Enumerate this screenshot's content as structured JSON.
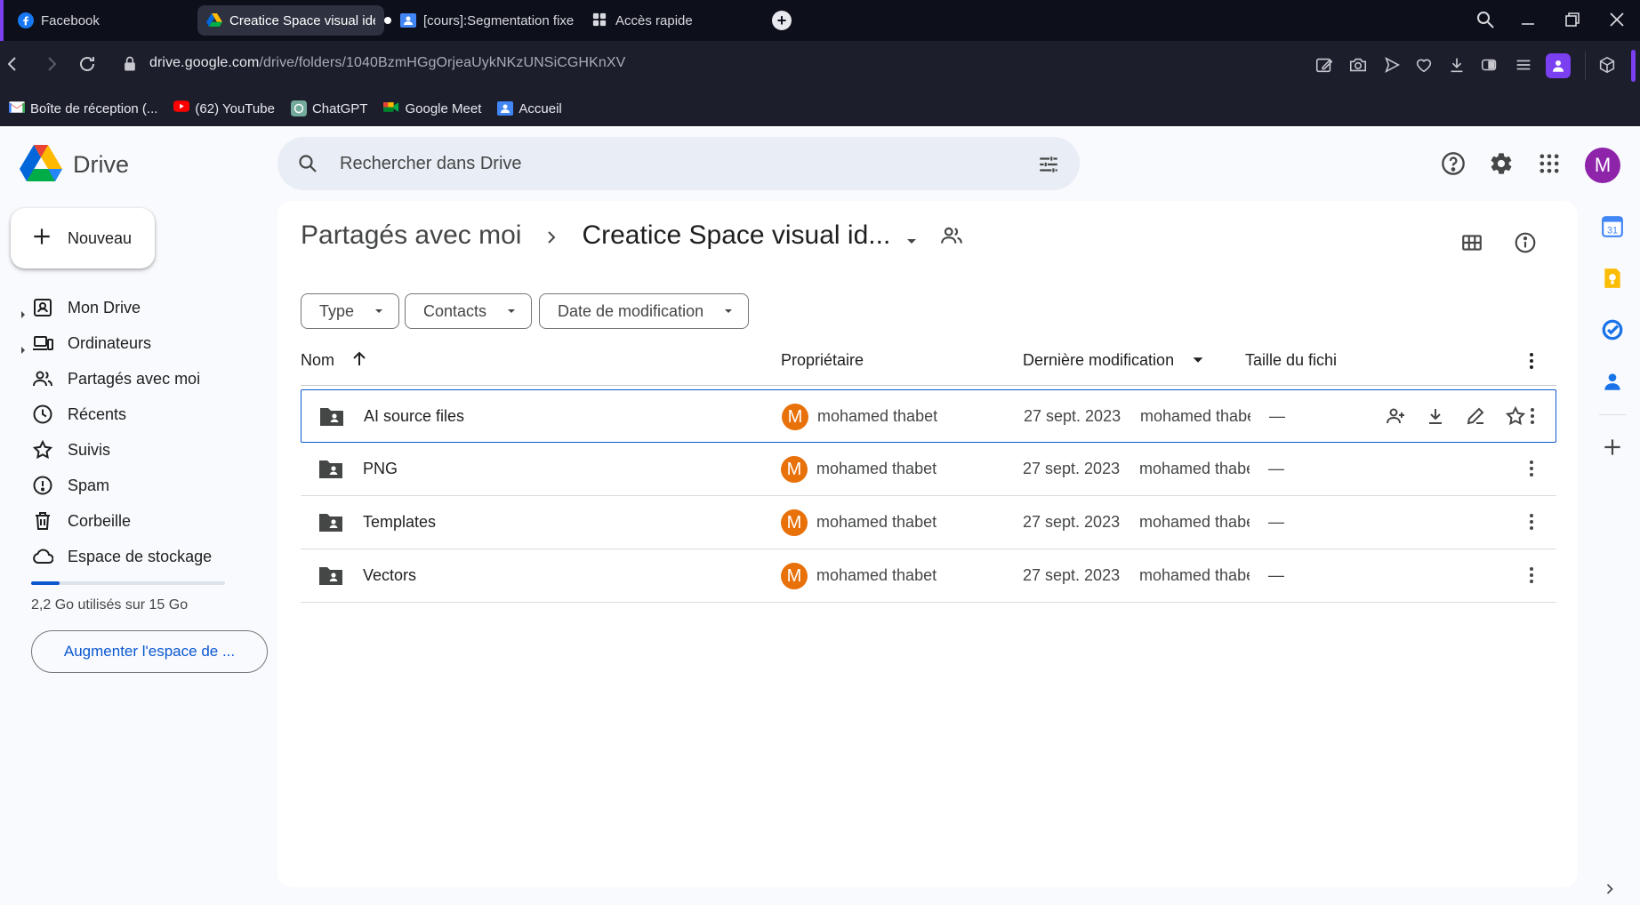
{
  "browser": {
    "tabs": [
      {
        "title": "Facebook",
        "active": false
      },
      {
        "title": "Creatice Space visual iden",
        "active": true
      },
      {
        "title": "[cours]:Segmentation fixe",
        "active": false
      },
      {
        "title": "Accès rapide",
        "active": false
      }
    ],
    "url_host": "drive.google.com",
    "url_path": "/drive/folders/1040BzmHGgOrjeaUykNKzUNSiCGHKnXV",
    "bookmarks": [
      {
        "label": "Boîte de réception (..."
      },
      {
        "label": "(62) YouTube"
      },
      {
        "label": "ChatGPT"
      },
      {
        "label": "Google Meet"
      },
      {
        "label": "Accueil"
      }
    ]
  },
  "drive": {
    "logo_text": "Drive",
    "search_placeholder": "Rechercher dans Drive",
    "new_label": "Nouveau",
    "account_initial": "M",
    "nav": [
      {
        "label": "Mon Drive",
        "icon": "my-drive-icon"
      },
      {
        "label": "Ordinateurs",
        "icon": "computers-icon"
      },
      {
        "label": "Partagés avec moi",
        "icon": "shared-icon"
      },
      {
        "label": "Récents",
        "icon": "clock-icon"
      },
      {
        "label": "Suivis",
        "icon": "star-icon"
      },
      {
        "label": "Spam",
        "icon": "spam-icon"
      },
      {
        "label": "Corbeille",
        "icon": "trash-icon"
      },
      {
        "label": "Espace de stockage",
        "icon": "cloud-icon"
      }
    ],
    "storage": {
      "text": "2,2 Go utilisés sur 15 Go",
      "used_fraction": 0.147
    },
    "upgrade_label": "Augmenter l'espace de ...",
    "breadcrumb": {
      "root": "Partagés avec moi",
      "current": "Creatice Space visual id..."
    },
    "filters": [
      "Type",
      "Contacts",
      "Date de modification"
    ],
    "columns": {
      "name": "Nom",
      "owner": "Propriétaire",
      "modified": "Dernière modification",
      "size": "Taille du fichi"
    },
    "files": [
      {
        "name": "AI source files",
        "owner_initial": "M",
        "owner": "mohamed thabet",
        "date": "27 sept. 2023",
        "modified_by": "mohamed thabet",
        "size": "—",
        "selected": true
      },
      {
        "name": "PNG",
        "owner_initial": "M",
        "owner": "mohamed thabet",
        "date": "27 sept. 2023",
        "modified_by": "mohamed thabet",
        "size": "—",
        "selected": false
      },
      {
        "name": "Templates",
        "owner_initial": "M",
        "owner": "mohamed thabet",
        "date": "27 sept. 2023",
        "modified_by": "mohamed thabet",
        "size": "—",
        "selected": false
      },
      {
        "name": "Vectors",
        "owner_initial": "M",
        "owner": "mohamed thabet",
        "date": "27 sept. 2023",
        "modified_by": "mohamed thabet",
        "size": "—",
        "selected": false
      }
    ],
    "calendar_day": "31",
    "colors": {
      "accent": "#0b57d0",
      "avatar": "#8e24aa",
      "owner_avatar": "#e8710a"
    }
  }
}
